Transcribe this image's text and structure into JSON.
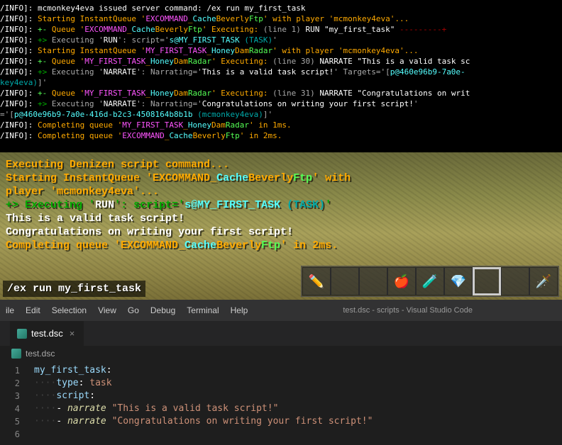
{
  "console": {
    "lines": [
      {
        "segments": [
          {
            "t": "/INFO]:",
            "c": "white"
          },
          {
            "t": " mcmonkey4eva issued server command: /ex run my_first_task",
            "c": "white"
          }
        ]
      },
      {
        "segments": [
          {
            "t": "/INFO]:",
            "c": "white"
          },
          {
            "t": "  Starting InstantQueue '",
            "c": "yellow"
          },
          {
            "t": "EXCOMMAND",
            "c": "pink"
          },
          {
            "t": "_",
            "c": "yellow"
          },
          {
            "t": "Cache",
            "c": "cyan"
          },
          {
            "t": "Beverly",
            "c": "yellow"
          },
          {
            "t": "Ftp",
            "c": "green"
          },
          {
            "t": "' with player 'mcmonkey4eva'...",
            "c": "yellow"
          }
        ]
      },
      {
        "segments": [
          {
            "t": "/INFO]:",
            "c": "white"
          },
          {
            "t": " +- ",
            "c": "green"
          },
          {
            "t": "Queue '",
            "c": "yellow"
          },
          {
            "t": "EXCOMMAND",
            "c": "pink"
          },
          {
            "t": "_",
            "c": "yellow"
          },
          {
            "t": "Cache",
            "c": "cyan"
          },
          {
            "t": "Beverly",
            "c": "yellow"
          },
          {
            "t": "Ftp",
            "c": "green"
          },
          {
            "t": "' Executing:",
            "c": "yellow"
          },
          {
            "t": " (line 1) ",
            "c": "gray"
          },
          {
            "t": "RUN \"my_first_task\"",
            "c": "white"
          },
          {
            "t": " ---------+",
            "c": "darkred"
          }
        ]
      },
      {
        "segments": [
          {
            "t": "/INFO]:",
            "c": "white"
          },
          {
            "t": " +> ",
            "c": "darkgreen"
          },
          {
            "t": "Executing '",
            "c": "gray"
          },
          {
            "t": "RUN",
            "c": "white"
          },
          {
            "t": "': script='",
            "c": "gray"
          },
          {
            "t": "s@MY_FIRST_TASK ",
            "c": "cyan"
          },
          {
            "t": "(TASK)",
            "c": "darkcyan"
          },
          {
            "t": "'",
            "c": "gray"
          }
        ]
      },
      {
        "segments": [
          {
            "t": "/INFO]:",
            "c": "white"
          },
          {
            "t": "  Starting InstantQueue '",
            "c": "yellow"
          },
          {
            "t": "MY_FIRST_TASK",
            "c": "pink"
          },
          {
            "t": "_",
            "c": "yellow"
          },
          {
            "t": "Honey",
            "c": "cyan"
          },
          {
            "t": "Dam",
            "c": "yellow"
          },
          {
            "t": "Radar",
            "c": "green"
          },
          {
            "t": "' with player 'mcmonkey4eva'...",
            "c": "yellow"
          }
        ]
      },
      {
        "segments": [
          {
            "t": "/INFO]:",
            "c": "white"
          },
          {
            "t": " +- ",
            "c": "green"
          },
          {
            "t": "Queue '",
            "c": "yellow"
          },
          {
            "t": "MY_FIRST_TASK",
            "c": "pink"
          },
          {
            "t": "_",
            "c": "yellow"
          },
          {
            "t": "Honey",
            "c": "cyan"
          },
          {
            "t": "Dam",
            "c": "yellow"
          },
          {
            "t": "Radar",
            "c": "green"
          },
          {
            "t": "' Executing:",
            "c": "yellow"
          },
          {
            "t": " (line 30) ",
            "c": "gray"
          },
          {
            "t": "NARRATE \"This is a valid task sc",
            "c": "white"
          }
        ]
      },
      {
        "segments": [
          {
            "t": "/INFO]:",
            "c": "white"
          },
          {
            "t": " +> ",
            "c": "darkgreen"
          },
          {
            "t": "Executing '",
            "c": "gray"
          },
          {
            "t": "NARRATE",
            "c": "white"
          },
          {
            "t": "': Narrating='",
            "c": "gray"
          },
          {
            "t": "This is a valid task script!",
            "c": "white"
          },
          {
            "t": "'  Targets='[",
            "c": "gray"
          },
          {
            "t": "p@460e96b9-7a0e-",
            "c": "cyan"
          }
        ]
      },
      {
        "segments": [
          {
            "t": "key4eva)",
            "c": "darkcyan"
          },
          {
            "t": "]'",
            "c": "gray"
          }
        ]
      },
      {
        "segments": [
          {
            "t": "/INFO]:",
            "c": "white"
          },
          {
            "t": " +- ",
            "c": "green"
          },
          {
            "t": "Queue '",
            "c": "yellow"
          },
          {
            "t": "MY_FIRST_TASK",
            "c": "pink"
          },
          {
            "t": "_",
            "c": "yellow"
          },
          {
            "t": "Honey",
            "c": "cyan"
          },
          {
            "t": "Dam",
            "c": "yellow"
          },
          {
            "t": "Radar",
            "c": "green"
          },
          {
            "t": "' Executing:",
            "c": "yellow"
          },
          {
            "t": " (line 31) ",
            "c": "gray"
          },
          {
            "t": "NARRATE \"Congratulations on writ",
            "c": "white"
          }
        ]
      },
      {
        "segments": [
          {
            "t": "/INFO]:",
            "c": "white"
          },
          {
            "t": " +> ",
            "c": "darkgreen"
          },
          {
            "t": "Executing '",
            "c": "gray"
          },
          {
            "t": "NARRATE",
            "c": "white"
          },
          {
            "t": "': Narrating='",
            "c": "gray"
          },
          {
            "t": "Congratulations on writing your first script!",
            "c": "white"
          },
          {
            "t": "'",
            "c": "gray"
          }
        ]
      },
      {
        "segments": [
          {
            "t": "='[",
            "c": "gray"
          },
          {
            "t": "p@460e96b9-7a0e-416d-b2c3-4508164b8b1b ",
            "c": "cyan"
          },
          {
            "t": "(mcmonkey4eva)",
            "c": "darkcyan"
          },
          {
            "t": "]'",
            "c": "gray"
          }
        ]
      },
      {
        "segments": [
          {
            "t": "/INFO]:",
            "c": "white"
          },
          {
            "t": "  Completing queue '",
            "c": "yellow"
          },
          {
            "t": "MY_FIRST_TASK",
            "c": "pink"
          },
          {
            "t": "_",
            "c": "yellow"
          },
          {
            "t": "Honey",
            "c": "cyan"
          },
          {
            "t": "Dam",
            "c": "yellow"
          },
          {
            "t": "Radar",
            "c": "green"
          },
          {
            "t": "' in 1ms.",
            "c": "yellow"
          }
        ]
      },
      {
        "segments": [
          {
            "t": "/INFO]:",
            "c": "white"
          },
          {
            "t": "  Completing queue '",
            "c": "yellow"
          },
          {
            "t": "EXCOMMAND",
            "c": "pink"
          },
          {
            "t": "_",
            "c": "yellow"
          },
          {
            "t": "Cache",
            "c": "cyan"
          },
          {
            "t": "Beverly",
            "c": "yellow"
          },
          {
            "t": "Ftp",
            "c": "green"
          },
          {
            "t": "' in 2ms.",
            "c": "yellow"
          }
        ]
      }
    ]
  },
  "game_chat": {
    "lines": [
      {
        "segments": [
          {
            "t": "Executing Denizen script command...",
            "c": "go"
          }
        ]
      },
      {
        "segments": [
          {
            "t": " Starting InstantQueue 'EXCOMMAND_",
            "c": "go"
          },
          {
            "t": "Cache",
            "c": "lc"
          },
          {
            "t": "Beverly",
            "c": "go"
          },
          {
            "t": "Ftp",
            "c": "lg"
          },
          {
            "t": "' with",
            "c": "go"
          }
        ]
      },
      {
        "segments": [
          {
            "t": " player 'mcmonkey4eva'...",
            "c": "go"
          }
        ]
      },
      {
        "segments": [
          {
            "t": "+>",
            "c": "gr"
          },
          {
            "t": " Executing '",
            "c": "gr"
          },
          {
            "t": "RUN",
            "c": "w"
          },
          {
            "t": "': script='",
            "c": "gr"
          },
          {
            "t": "s@MY_FIRST_TASK ",
            "c": "lc"
          },
          {
            "t": "(TASK)",
            "c": "cy"
          },
          {
            "t": "'",
            "c": "gr"
          }
        ]
      },
      {
        "segments": [
          {
            "t": "This is a valid task script!",
            "c": "w"
          }
        ]
      },
      {
        "segments": [
          {
            "t": "Congratulations on writing your first script!",
            "c": "w"
          }
        ]
      },
      {
        "segments": [
          {
            "t": " Completing queue 'EXCOMMAND_",
            "c": "go"
          },
          {
            "t": "Cache",
            "c": "lc"
          },
          {
            "t": "Beverly",
            "c": "go"
          },
          {
            "t": "Ftp",
            "c": "lg"
          },
          {
            "t": "' in 2ms.",
            "c": "go"
          }
        ]
      }
    ],
    "input": "/ex run my_first_task"
  },
  "hotbar": {
    "slots": [
      "✏️",
      "",
      "",
      "🍎",
      "🧪",
      "💎",
      "",
      "",
      "🗡️"
    ],
    "selected": 6
  },
  "vscode": {
    "menu": [
      "ile",
      "Edit",
      "Selection",
      "View",
      "Go",
      "Debug",
      "Terminal",
      "Help"
    ],
    "title": "test.dsc - scripts - Visual Studio Code",
    "tab": "test.dsc",
    "breadcrumb": "test.dsc",
    "code": [
      {
        "n": 1,
        "i": 0,
        "k": "my_first_task",
        "v": ":"
      },
      {
        "n": 2,
        "i": 1,
        "k": "type",
        "v": ": ",
        "val": "task"
      },
      {
        "n": 3,
        "i": 1,
        "k": "script",
        "v": ":"
      },
      {
        "n": 4,
        "i": 1,
        "dash": true,
        "nar": "narrate",
        "str": " \"This is a valid task script!\""
      },
      {
        "n": 5,
        "i": 1,
        "dash": true,
        "nar": "narrate",
        "str": " \"Congratulations on writing your first script!\""
      },
      {
        "n": 6,
        "i": 0
      }
    ]
  }
}
